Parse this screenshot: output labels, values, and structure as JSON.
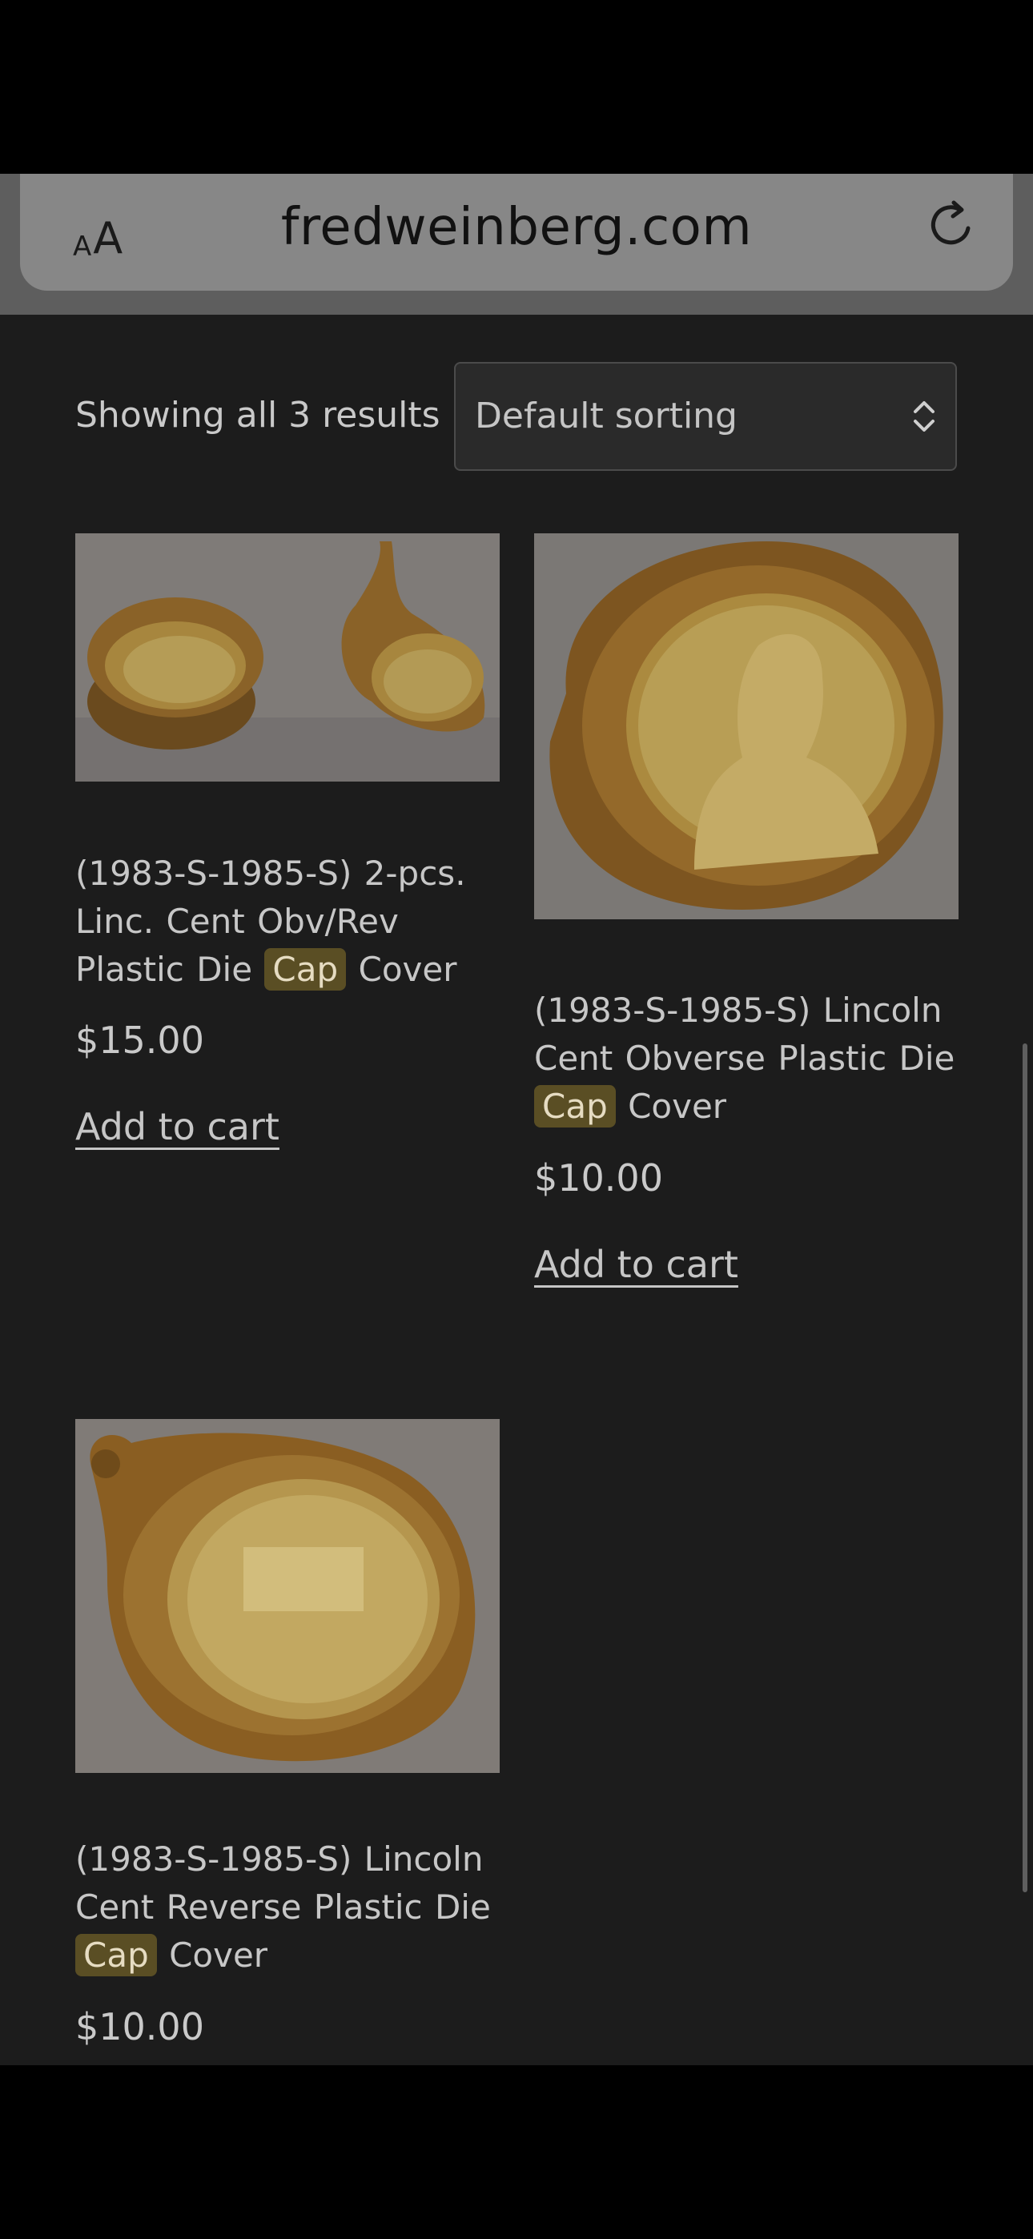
{
  "browser": {
    "aa_small": "A",
    "aa_big": "A",
    "url": "fredweinberg.com",
    "reload_icon": "reload-icon"
  },
  "shop": {
    "result_count": "Showing all 3 results",
    "sorting": {
      "selected": "Default sorting",
      "icon": "chevron-up-down-icon"
    }
  },
  "products": [
    {
      "title_before": "(1983-S-1985-S) 2-pcs. Linc. Cent Obv/Rev Plastic Die",
      "title_highlight": "Cap",
      "title_after": "Cover",
      "price": "$15.00",
      "add_to_cart": "Add to cart"
    },
    {
      "title_before": "(1983-S-1985-S) Lincoln Cent Obverse Plastic Die",
      "title_highlight": "Cap",
      "title_after": "Cover",
      "price": "$10.00",
      "add_to_cart": "Add to cart"
    },
    {
      "title_before": "(1983-S-1985-S) Lincoln Cent Reverse Plastic Die",
      "title_highlight": "Cap",
      "title_after": "Cover",
      "price": "$10.00"
    }
  ]
}
